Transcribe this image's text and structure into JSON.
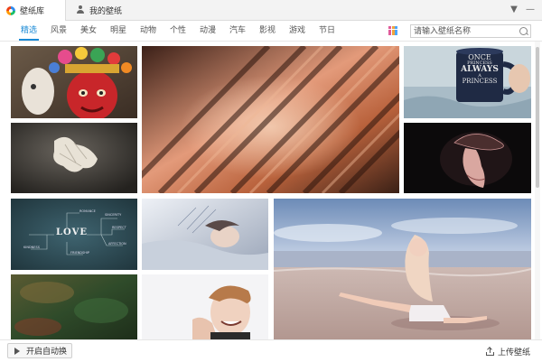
{
  "window": {
    "tabs": [
      {
        "label": "壁纸库",
        "icon": "wallpaper-library-icon",
        "active": true
      },
      {
        "label": "我的壁纸",
        "icon": "user-icon",
        "active": false
      }
    ],
    "controls": {
      "menu": "▼",
      "minimize": "—"
    }
  },
  "categories": [
    "精选",
    "风景",
    "美女",
    "明星",
    "动物",
    "个性",
    "动漫",
    "汽车",
    "影视",
    "游戏",
    "节日"
  ],
  "active_category": "精选",
  "search": {
    "placeholder": "请输入壁纸名称"
  },
  "thumbnails": [
    {
      "name": "thumb-mask-doll",
      "subject": "Colorful festival mask with flowers"
    },
    {
      "name": "thumb-abstract-stripes",
      "subject": "Warm diagonal abstract stripes"
    },
    {
      "name": "thumb-mug",
      "subject": "Mug with text"
    },
    {
      "name": "thumb-paper-flower",
      "subject": "Crumpled white paper on dark background"
    },
    {
      "name": "thumb-woman-hat",
      "subject": "Silhouette of woman in hat"
    },
    {
      "name": "thumb-love-board",
      "subject": "Chalkboard with word LOVE"
    },
    {
      "name": "thumb-sleeping-girl",
      "subject": "Girl lying in bed"
    },
    {
      "name": "thumb-beach-girl",
      "subject": "Girl sitting on beach"
    },
    {
      "name": "thumb-green-forest",
      "subject": "Green forest texture"
    },
    {
      "name": "thumb-smiling-man",
      "subject": "Smiling man portrait"
    }
  ],
  "mug_text": {
    "line1": "ONCE",
    "line2": "PRINCESS",
    "line3": "ALWAYS",
    "line4": "A",
    "line5": "PRINCESS"
  },
  "love_board": {
    "main": "LOVE",
    "w1": "SINCERITY",
    "w2": "ROMANCE",
    "w3": "RESPECT",
    "w4": "KINDNESS",
    "w5": "FRIENDSHIP",
    "w6": "AFFECTION"
  },
  "bottom": {
    "auto_switch": "开启自动换",
    "upload": "上传壁纸"
  },
  "colors": {
    "accent": "#1a8ad6"
  }
}
